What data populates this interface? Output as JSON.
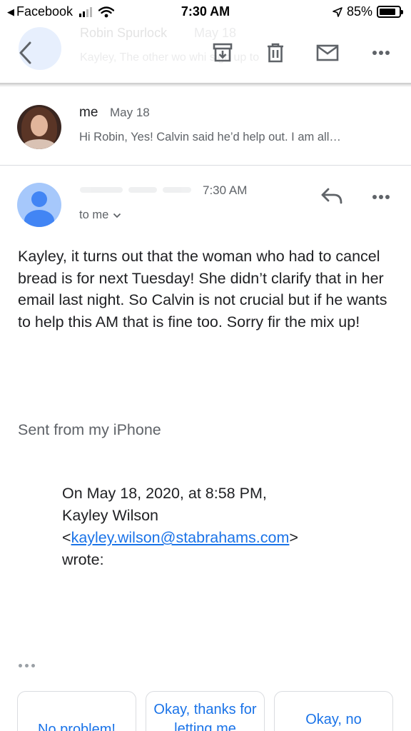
{
  "status_bar": {
    "back_app": "Facebook",
    "time": "7:30 AM",
    "battery": "85%",
    "battery_level": 0.85
  },
  "toolbar": {
    "icons": [
      "back-arrow-icon",
      "archive-icon",
      "trash-icon",
      "mail-icon",
      "more-icon"
    ],
    "behind": {
      "sender": "Robin Spurlock",
      "date": "May 18",
      "snippet": "Kayley, The other wo      whi      sign     up to"
    }
  },
  "collapsed_message": {
    "sender": "me",
    "date": "May 18",
    "snippet": "Hi Robin, Yes! Calvin said he’d help out. I am all…"
  },
  "expanded_message": {
    "time": "7:30 AM",
    "to_label": "to me",
    "body": "Kayley, it turns out that the woman who had to cancel bread is for next Tuesday!  She didn’t clarify that in her email last night.  So Calvin is not crucial but if he wants to help this AM that is fine too.  Sorry fir the mix up!",
    "signature": "Sent from my iPhone",
    "quote": {
      "line1": "On May 18, 2020, at 8:58 PM,",
      "line2": "Kayley Wilson",
      "open": "<",
      "email": "kayley.wilson@stabrahams.com",
      "close": ">",
      "line4": "wrote:"
    }
  },
  "smart_replies": [
    "No problem!",
    "Okay, thanks for letting me",
    "Okay, no"
  ],
  "colors": {
    "accent_blue": "#1a73e8",
    "avatar_blue": "#4285f4",
    "avatar_light": "#a6c8fb",
    "secondary_text": "#5f6368"
  }
}
